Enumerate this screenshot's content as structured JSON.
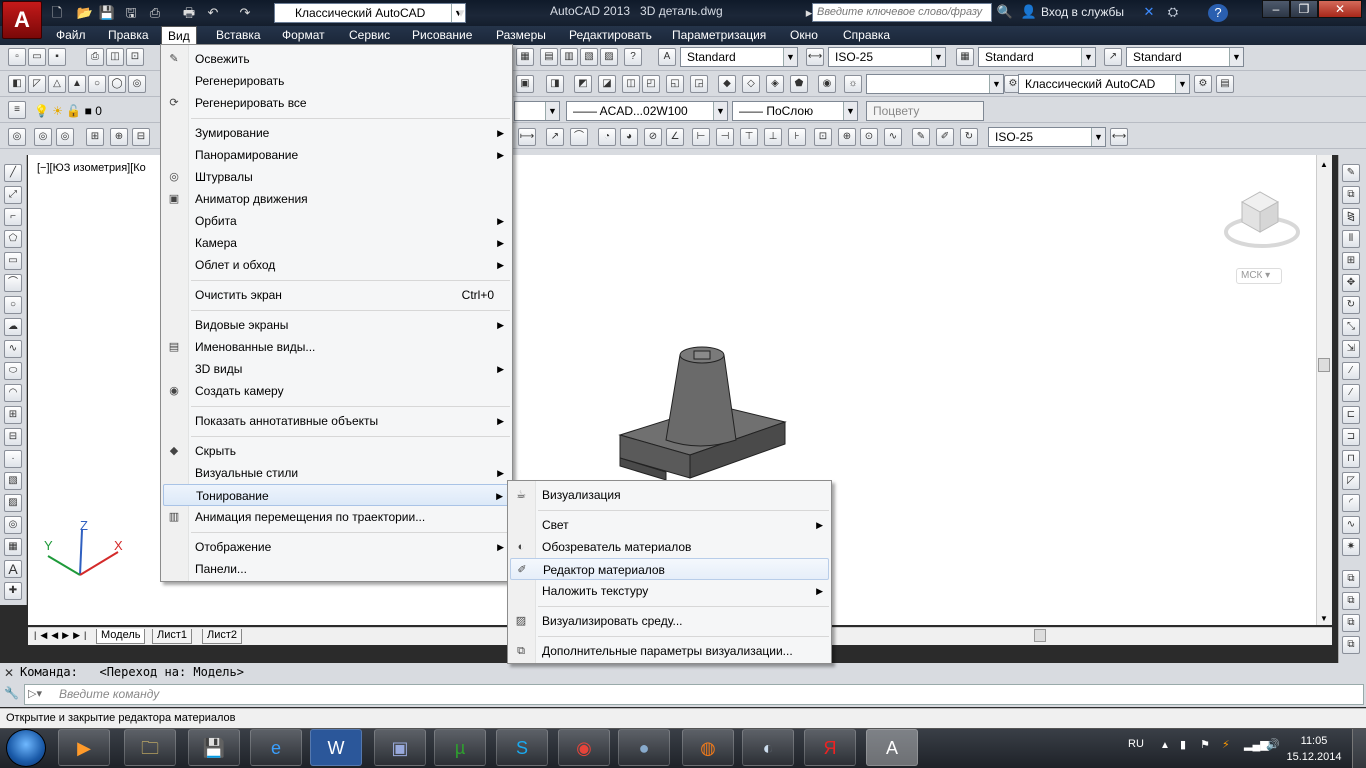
{
  "app": {
    "logo": "A",
    "title": "AutoCAD 2013   3D деталь.dwg"
  },
  "quickaccess": {
    "workspace": "Классический AutoCAD"
  },
  "infocenter": {
    "search_placeholder": "Введите ключевое слово/фразу",
    "signin": "Вход в службы"
  },
  "menubar": [
    "Файл",
    "Правка",
    "Вид",
    "Вставка",
    "Формат",
    "Сервис",
    "Рисование",
    "Размеры",
    "Редактировать",
    "Параметризация",
    "Окно",
    "Справка"
  ],
  "toolbars": {
    "text_style": "Standard",
    "dim_style": "ISO-25",
    "table_style": "Standard",
    "mleader_style": "Standard",
    "workspace": "Классический AutoCAD",
    "layer": "0",
    "linetype": "—— ACAD...02W100",
    "lineweight": "—— ПоСлою",
    "plotstyle": "Поцвету",
    "dim_style2": "ISO-25"
  },
  "viewport": {
    "label": "[−][ЮЗ изометрия][Ко",
    "cube_label": "МСК",
    "axes": {
      "x": "X",
      "y": "Y",
      "z": "Z"
    }
  },
  "layout_tabs": [
    "Модель",
    "Лист1",
    "Лист2"
  ],
  "command": {
    "history_label": "Команда:",
    "history_value": "<Переход на: Модель>",
    "placeholder": "Введите команду"
  },
  "status_text": "Открытие и закрытие редактора материалов",
  "view_menu": [
    {
      "label": "Освежить",
      "icon": "brush-icon"
    },
    {
      "label": "Регенерировать"
    },
    {
      "label": "Регенерировать все",
      "icon": "regen-all-icon"
    },
    {
      "sep": true
    },
    {
      "label": "Зумирование",
      "sub": true
    },
    {
      "label": "Панорамирование",
      "sub": true
    },
    {
      "label": "Штурвалы",
      "icon": "steering-wheel-icon"
    },
    {
      "label": "Аниматор движения",
      "icon": "showmotion-icon"
    },
    {
      "label": "Орбита",
      "sub": true
    },
    {
      "label": "Камера",
      "sub": true
    },
    {
      "label": "Облет и обход",
      "sub": true
    },
    {
      "sep": true
    },
    {
      "label": "Очистить экран",
      "shortcut": "Ctrl+0"
    },
    {
      "sep": true
    },
    {
      "label": "Видовые экраны",
      "sub": true
    },
    {
      "label": "Именованные виды...",
      "icon": "named-views-icon"
    },
    {
      "label": "3D виды",
      "sub": true
    },
    {
      "label": "Создать камеру",
      "icon": "camera-icon"
    },
    {
      "sep": true
    },
    {
      "label": "Показать аннотативные объекты",
      "sub": true
    },
    {
      "sep": true
    },
    {
      "label": "Скрыть",
      "icon": "hide-icon"
    },
    {
      "label": "Визуальные стили",
      "sub": true
    },
    {
      "label": "Тонирование",
      "sub": true,
      "active": true
    },
    {
      "label": "Анимация перемещения по траектории...",
      "icon": "motion-path-icon"
    },
    {
      "sep": true
    },
    {
      "label": "Отображение",
      "sub": true
    },
    {
      "label": "Панели..."
    }
  ],
  "render_menu": [
    {
      "label": "Визуализация",
      "icon": "teapot-icon"
    },
    {
      "sep": true
    },
    {
      "label": "Свет",
      "sub": true
    },
    {
      "label": "Обозреватель материалов",
      "icon": "materials-browser-icon"
    },
    {
      "label": "Редактор материалов",
      "icon": "materials-editor-icon",
      "active": true
    },
    {
      "label": "Наложить текстуру",
      "sub": true
    },
    {
      "sep": true
    },
    {
      "label": "Визуализировать среду...",
      "icon": "render-environment-icon"
    },
    {
      "sep": true
    },
    {
      "label": "Дополнительные параметры визуализации...",
      "icon": "advanced-render-icon"
    }
  ],
  "tray": {
    "lang": "RU",
    "time": "11:05",
    "date": "15.12.2014"
  }
}
